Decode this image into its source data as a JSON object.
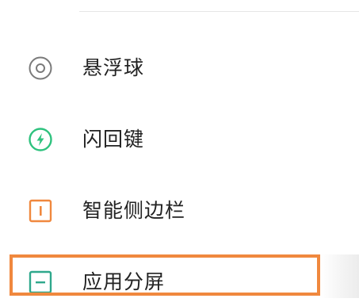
{
  "settings": {
    "items": [
      {
        "label": "悬浮球",
        "icon": "floating-ball-icon"
      },
      {
        "label": "闪回键",
        "icon": "flash-back-key-icon"
      },
      {
        "label": "智能侧边栏",
        "icon": "smart-sidebar-icon"
      },
      {
        "label": "应用分屏",
        "icon": "split-screen-icon"
      }
    ]
  },
  "colors": {
    "gray_icon": "#7a7a7a",
    "green_icon": "#2ec27e",
    "orange_icon": "#f0883e",
    "teal_icon": "#2fa88c",
    "highlight": "#f0883e",
    "text": "#222222"
  }
}
